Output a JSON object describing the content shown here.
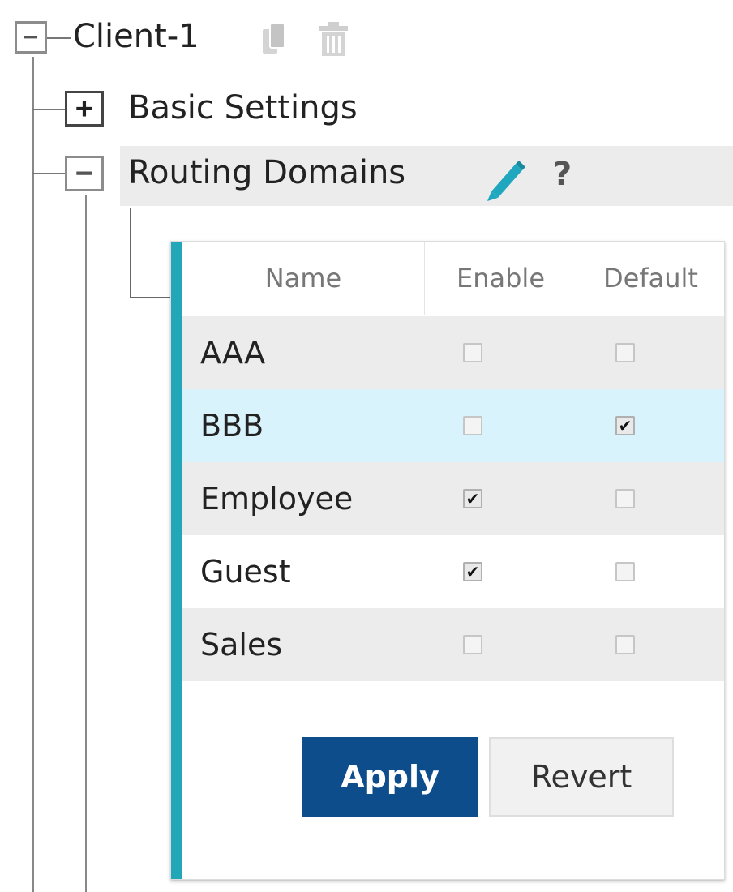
{
  "tree": {
    "root": {
      "label": "Client-1",
      "expander": "−"
    },
    "children": [
      {
        "label": "Basic Settings",
        "expander": "+"
      },
      {
        "label": "Routing Domains",
        "expander": "−",
        "help": "?"
      }
    ]
  },
  "icons": {
    "copy": "copy-icon",
    "trash": "trash-icon",
    "edit": "pencil-icon"
  },
  "colors": {
    "accent": "#22a7b8",
    "pencil": "#1fa7c0",
    "apply_button": "#0d4d8c",
    "highlight_row": "#d8f3fb",
    "alt_row": "#ececec"
  },
  "table": {
    "headers": [
      "Name",
      "Enable",
      "Default"
    ],
    "rows": [
      {
        "name": "AAA",
        "enable": false,
        "default": false
      },
      {
        "name": "BBB",
        "enable": false,
        "default": true
      },
      {
        "name": "Employee",
        "enable": true,
        "default": false
      },
      {
        "name": "Guest",
        "enable": true,
        "default": false
      },
      {
        "name": "Sales",
        "enable": false,
        "default": false
      }
    ],
    "check_mark": "✔"
  },
  "buttons": {
    "apply": "Apply",
    "revert": "Revert"
  }
}
